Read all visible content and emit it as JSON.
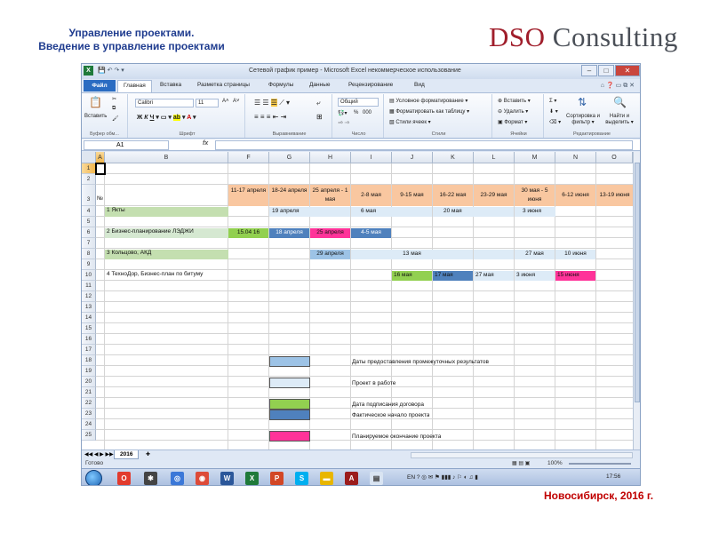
{
  "slide": {
    "title_line1": "Управление проектами.",
    "title_line2": "Введение в управление проектами",
    "brand": "DSO Consulting",
    "footer": "Новосибирск, 2016 г."
  },
  "excel": {
    "window_title": "Сетевой график пример - Microsoft Excel некоммерческое использование",
    "quick_access": "💾 ↶ ↷ ▾",
    "tabs": [
      "Файл",
      "Главная",
      "Вставка",
      "Разметка страницы",
      "Формулы",
      "Данные",
      "Рецензирование",
      "Вид"
    ],
    "active_tab": "Главная",
    "ribbon": {
      "clipboard": {
        "paste": "Вставить",
        "label": "Буфер обм..."
      },
      "font": {
        "name": "Calibri",
        "size": "11",
        "label": "Шрифт",
        "grow": "A˄",
        "shrink": "A˅"
      },
      "alignment": {
        "label": "Выравнивание"
      },
      "number": {
        "format": "Общий",
        "percent": "%",
        "thousands": "000",
        "label": "Число"
      },
      "styles": {
        "cond": "Условное форматирование ▾",
        "table": "Форматировать как таблицу ▾",
        "cell": "Стили ячеек ▾",
        "label": "Стили"
      },
      "cells": {
        "insert": "Вставить ▾",
        "delete": "Удалить ▾",
        "format": "Формат ▾",
        "label": "Ячейки"
      },
      "editing": {
        "sum": "Σ ▾",
        "sort": "Сортировка и фильтр ▾",
        "find": "Найти и выделить ▾",
        "label": "Редактирование"
      }
    },
    "name_box": "A1",
    "fx": "fx",
    "columns": [
      "A",
      "B",
      "F",
      "G",
      "H",
      "I",
      "J",
      "K",
      "L",
      "M",
      "N",
      "O"
    ],
    "selected_column": "A",
    "rows": [
      "1",
      "2",
      "3",
      "4",
      "5",
      "6",
      "7",
      "8",
      "9",
      "10",
      "11",
      "12",
      "13",
      "14",
      "15",
      "16",
      "17",
      "18",
      "19",
      "20",
      "21",
      "22",
      "23",
      "24",
      "25"
    ],
    "selected_row": "1",
    "header_row": {
      "no": "№",
      "weeks": [
        "11-17 апреля",
        "18-24 апреля",
        "25 апреля - 1 мая",
        "2-8 мая",
        "9-15 мая",
        "16-22 мая",
        "23-29 мая",
        "30 мая - 5 июня",
        "6-12 июня",
        "13-19 июня"
      ]
    },
    "projects": [
      {
        "num": "1",
        "name": "Якты"
      },
      {
        "num": "2",
        "name": "Бизнес-планирование ЛЭДЖИ"
      },
      {
        "num": "3",
        "name": "Кольцово, АКД"
      },
      {
        "num": "4",
        "name": "ТехноДор, Бизнес-план по битуму"
      }
    ],
    "bars": {
      "r4": [
        "19 апреля",
        "6 мая",
        "20 мая",
        "3 июня"
      ],
      "r6": [
        "15.04 16",
        "18 апреля",
        "25 апреля",
        "4-5 мая"
      ],
      "r8": [
        "29 апреля",
        "13 мая",
        "27 мая",
        "10 июня"
      ],
      "r10": [
        "16 мая",
        "17 мая",
        "27 мая",
        "3 июня",
        "15 июня"
      ]
    },
    "legend": [
      "Даты предоставления промежуточных результатов",
      "Проект в работе",
      "Дата подписания договора",
      "Фактическое начало проекта",
      "Планируемое окончание проекта"
    ],
    "sheet_tab": "2016",
    "status": "Готово",
    "zoom": "100%",
    "taskbar": {
      "lang": "EN",
      "time": "17:56"
    },
    "colors": {
      "header_orange": "#f9c7a0",
      "light_blue": "#9dc3e6",
      "pale_blue": "#ddebf7",
      "green": "#92d050",
      "blue": "#4f81bd",
      "pink": "#ff3399",
      "brand_red": "#a01e2b"
    }
  }
}
